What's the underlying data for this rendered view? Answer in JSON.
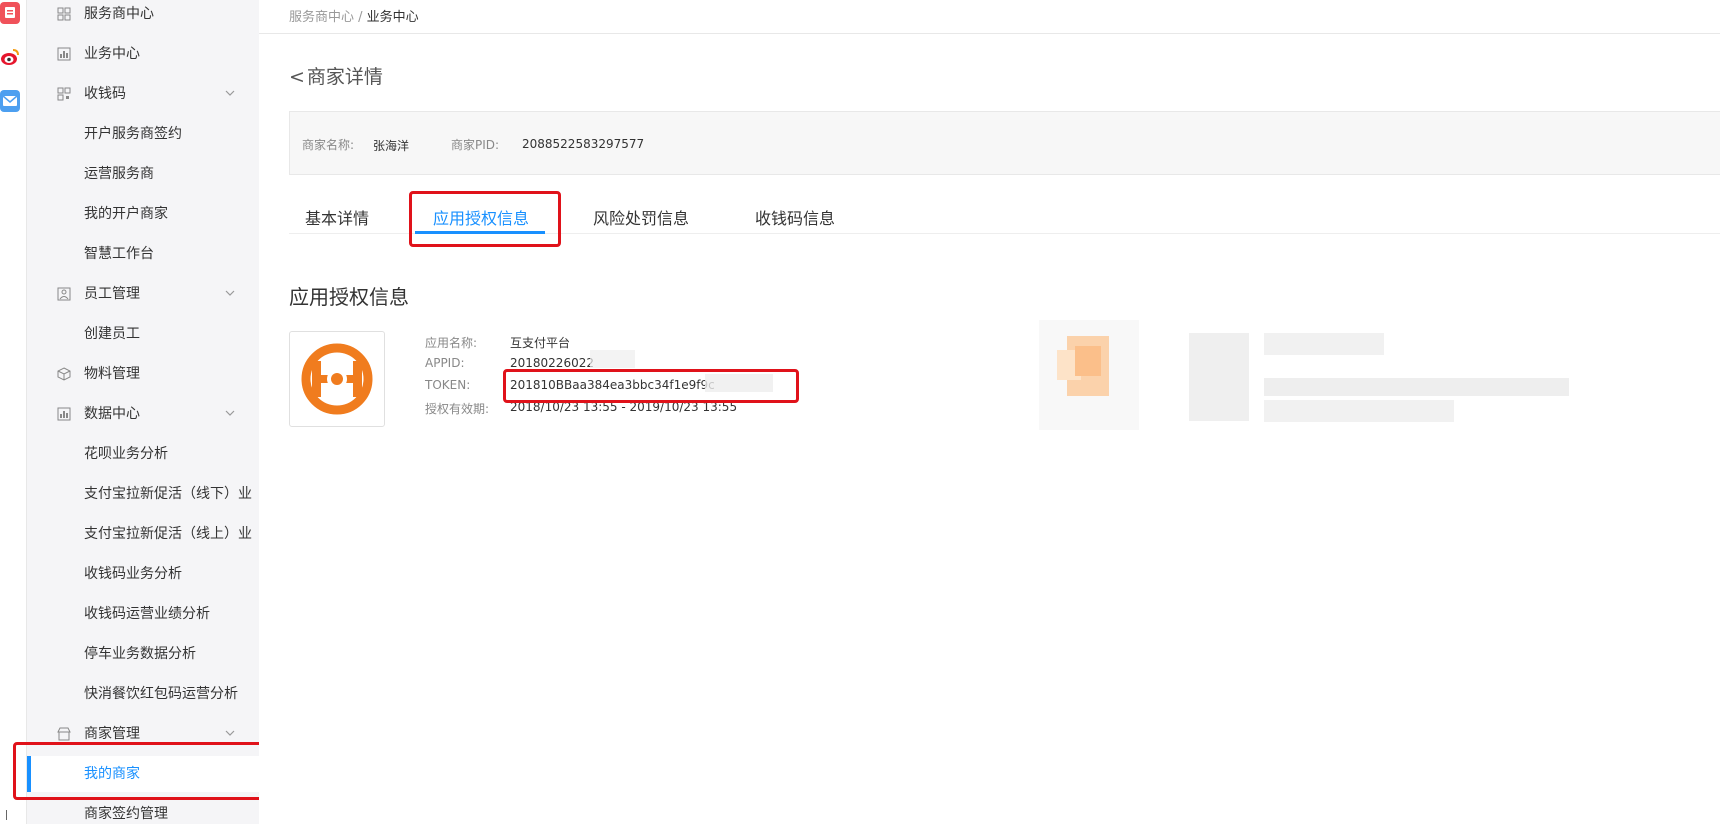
{
  "app_strip": {
    "icons": [
      "notes-app-icon",
      "weibo-icon",
      "mail-icon"
    ]
  },
  "sidebar": {
    "items": [
      {
        "label": "服务商中心",
        "type": "group",
        "icon": "grid-icon"
      },
      {
        "label": "业务中心",
        "type": "group",
        "icon": "chart-icon"
      },
      {
        "label": "收钱码",
        "type": "group",
        "icon": "qr-icon",
        "expandable": true
      },
      {
        "label": "开户服务商签约",
        "type": "sub"
      },
      {
        "label": "运营服务商",
        "type": "sub"
      },
      {
        "label": "我的开户商家",
        "type": "sub"
      },
      {
        "label": "智慧工作台",
        "type": "sub"
      },
      {
        "label": "员工管理",
        "type": "group",
        "icon": "staff-icon",
        "expandable": true
      },
      {
        "label": "创建员工",
        "type": "sub"
      },
      {
        "label": "物料管理",
        "type": "group",
        "icon": "cube-icon"
      },
      {
        "label": "数据中心",
        "type": "group",
        "icon": "data-icon",
        "expandable": true
      },
      {
        "label": "花呗业务分析",
        "type": "sub"
      },
      {
        "label": "支付宝拉新促活（线下）业",
        "type": "sub"
      },
      {
        "label": "支付宝拉新促活（线上）业",
        "type": "sub"
      },
      {
        "label": "收钱码业务分析",
        "type": "sub"
      },
      {
        "label": "收钱码运营业绩分析",
        "type": "sub"
      },
      {
        "label": "停车业务数据分析",
        "type": "sub"
      },
      {
        "label": "快消餐饮红包码运营分析",
        "type": "sub"
      },
      {
        "label": "商家管理",
        "type": "group",
        "icon": "store-icon",
        "expandable": true
      },
      {
        "label": "我的商家",
        "type": "sub",
        "active": true
      },
      {
        "label": "商家签约管理",
        "type": "sub"
      }
    ]
  },
  "breadcrumb": {
    "parent": "服务商中心",
    "separator": " / ",
    "current": "业务中心"
  },
  "page": {
    "title": "商家详情",
    "back_glyph": "<"
  },
  "merchant": {
    "name_label": "商家名称:",
    "name": "张海洋",
    "pid_label": "商家PID:",
    "pid": "2088522583297577"
  },
  "tabs": [
    {
      "label": "基本详情",
      "active": false
    },
    {
      "label": "应用授权信息",
      "active": true
    },
    {
      "label": "风险处罚信息",
      "active": false
    },
    {
      "label": "收钱码信息",
      "active": false
    }
  ],
  "section": {
    "title": "应用授权信息"
  },
  "app": {
    "name_label": "应用名称:",
    "name": "互支付平台",
    "appid_label": "APPID:",
    "appid": "20180226022",
    "token_label": "TOKEN:",
    "token": "201810BBaa384ea3bbc34f1e9f9c",
    "validity_label": "授权有效期:",
    "validity": "2018/10/23 13:55 - 2019/10/23 13:55"
  },
  "colors": {
    "accent": "#1890ff",
    "highlight": "#e0121a",
    "logo": "#f07c1e"
  }
}
